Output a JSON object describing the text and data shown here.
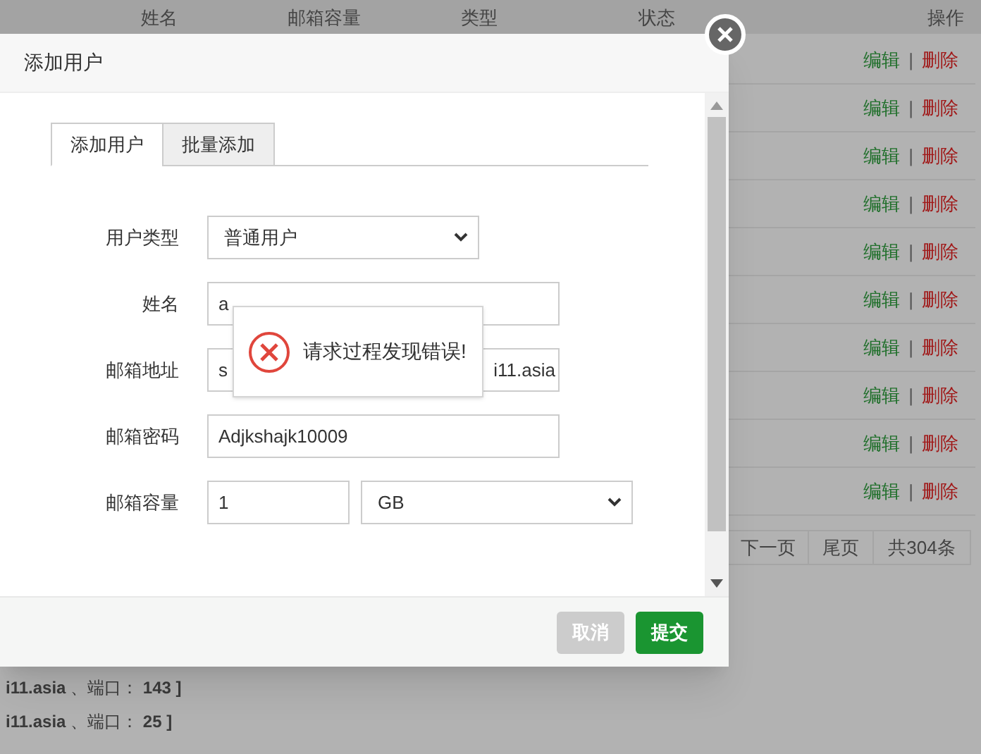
{
  "table": {
    "columns": [
      "姓名",
      "邮箱容量",
      "类型",
      "状态",
      "操作"
    ],
    "rows": [
      {
        "edit": "编辑",
        "sep": "|",
        "delete": "删除"
      },
      {
        "edit": "编辑",
        "sep": "|",
        "delete": "删除"
      },
      {
        "edit": "编辑",
        "sep": "|",
        "delete": "删除"
      },
      {
        "edit": "编辑",
        "sep": "|",
        "delete": "删除"
      },
      {
        "edit": "编辑",
        "sep": "|",
        "delete": "删除"
      },
      {
        "edit": "编辑",
        "sep": "|",
        "delete": "删除"
      },
      {
        "edit": "编辑",
        "sep": "|",
        "delete": "删除"
      },
      {
        "edit": "编辑",
        "sep": "|",
        "delete": "删除"
      },
      {
        "edit": "编辑",
        "sep": "|",
        "delete": "删除"
      },
      {
        "edit": "编辑",
        "sep": "|",
        "delete": "删除"
      }
    ]
  },
  "pagination": [
    "下一页",
    "尾页",
    "共304条"
  ],
  "notes": [
    "**i11.asia** 、端口： **143 ]**",
    "**i11.asia** 、端口： **25 ]**"
  ],
  "dialog": {
    "title": "添加用户",
    "tabs": [
      {
        "label": "添加用户",
        "selected": true
      },
      {
        "label": "批量添加",
        "selected": false
      }
    ],
    "fields": [
      {
        "kind": "select",
        "label": "用户类型",
        "value": "普通用户"
      },
      {
        "kind": "input",
        "label": "姓名",
        "value": "a"
      },
      {
        "kind": "split",
        "label": "邮箱地址",
        "value_start": "s",
        "value_end": "i11.asia"
      },
      {
        "kind": "input",
        "label": "邮箱密码",
        "value": "Adjkshajk10009"
      },
      {
        "kind": "capacity",
        "label": "邮箱容量",
        "value": "1",
        "unit": "GB"
      }
    ],
    "buttons": [
      {
        "label": "取消",
        "kind": "cancel"
      },
      {
        "label": "提交",
        "kind": "primary"
      }
    ]
  },
  "toast": {
    "message": "请求过程发现错误!"
  }
}
